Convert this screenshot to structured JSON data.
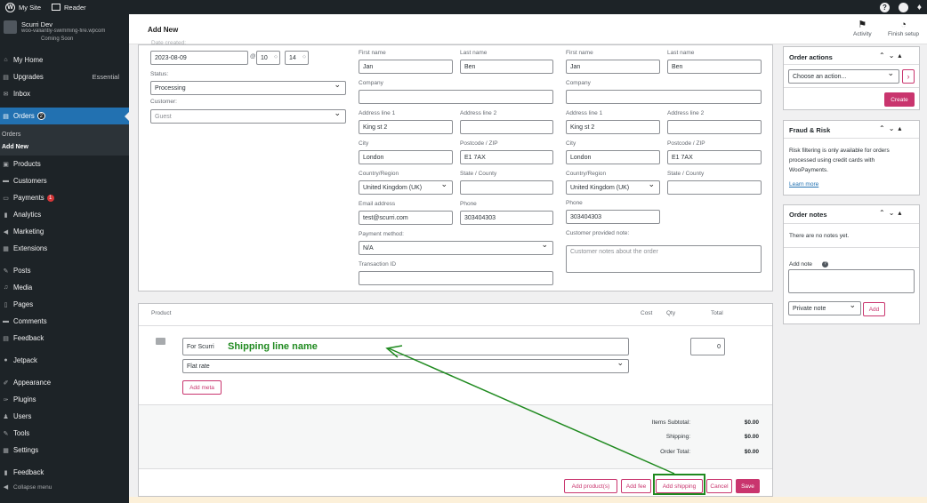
{
  "adminbar": {
    "my_site": "My Site",
    "reader": "Reader",
    "help_glyph": "?"
  },
  "site": {
    "name": "Scurri Dev",
    "url": "woo-valiantly-swimming-fire.wpcom",
    "status": "Coming Soon"
  },
  "nav": {
    "my_home": "My Home",
    "upgrades": "Upgrades",
    "upgrades_plan": "Essential",
    "inbox": "Inbox",
    "orders": "Orders",
    "orders_count": "2",
    "orders_sub": "Orders",
    "add_new": "Add New",
    "products": "Products",
    "customers": "Customers",
    "payments": "Payments",
    "payments_count": "1",
    "analytics": "Analytics",
    "marketing": "Marketing",
    "extensions": "Extensions",
    "posts": "Posts",
    "media": "Media",
    "pages": "Pages",
    "comments": "Comments",
    "feedback": "Feedback",
    "jetpack": "Jetpack",
    "appearance": "Appearance",
    "plugins": "Plugins",
    "users": "Users",
    "tools": "Tools",
    "settings": "Settings",
    "feedback2": "Feedback",
    "collapse": "Collapse menu"
  },
  "header": {
    "title": "Add New",
    "activity": "Activity",
    "finish_setup": "Finish setup"
  },
  "general": {
    "date_label": "Date created:",
    "date": "2023-08-09",
    "at": "@",
    "hour": "10",
    "minute": "14",
    "status_label": "Status:",
    "status": "Processing",
    "customer_label": "Customer:",
    "customer": "Guest"
  },
  "billing": {
    "first_name_label": "First name",
    "first_name": "Jan",
    "last_name_label": "Last name",
    "last_name": "Ben",
    "company_label": "Company",
    "company": "",
    "address1_label": "Address line 1",
    "address1": "King st 2",
    "address2_label": "Address line 2",
    "address2": "",
    "city_label": "City",
    "city": "London",
    "postcode_label": "Postcode / ZIP",
    "postcode": "E1 7AX",
    "country_label": "Country/Region",
    "country": "United Kingdom (UK)",
    "state_label": "State / County",
    "state": "",
    "email_label": "Email address",
    "email": "test@scurri.com",
    "phone_label": "Phone",
    "phone": "303404303",
    "payment_label": "Payment method:",
    "payment": "N/A",
    "transaction_label": "Transaction ID",
    "transaction": ""
  },
  "shipping": {
    "first_name_label": "First name",
    "first_name": "Jan",
    "last_name_label": "Last name",
    "last_name": "Ben",
    "company_label": "Company",
    "company": "",
    "address1_label": "Address line 1",
    "address1": "King st 2",
    "address2_label": "Address line 2",
    "address2": "",
    "city_label": "City",
    "city": "London",
    "postcode_label": "Postcode / ZIP",
    "postcode": "E1 7AX",
    "country_label": "Country/Region",
    "country": "United Kingdom (UK)",
    "state_label": "State / County",
    "state": "",
    "phone_label": "Phone",
    "phone": "303404303",
    "note_label": "Customer provided note:",
    "note_placeholder": "Customer notes about the order"
  },
  "items": {
    "col_product": "Product",
    "col_cost": "Cost",
    "col_qty": "Qty",
    "col_total": "Total",
    "line_name": "For Scurri",
    "method": "Flat rate",
    "line_total": "0",
    "add_meta": "Add meta",
    "subtotal_label": "Items Subtotal:",
    "subtotal": "$0.00",
    "shipping_label": "Shipping:",
    "shipping": "$0.00",
    "total_label": "Order Total:",
    "total": "$0.00",
    "btn_add_products": "Add product(s)",
    "btn_add_fee": "Add fee",
    "btn_add_shipping": "Add shipping",
    "btn_cancel": "Cancel",
    "btn_save": "Save"
  },
  "annotation": {
    "text": "Shipping line name",
    "color": "#1f8a1f"
  },
  "order_actions": {
    "title": "Order actions",
    "placeholder": "Choose an action...",
    "create": "Create"
  },
  "fraud": {
    "title": "Fraud & Risk",
    "text1": "Risk filtering is only available for orders",
    "text2": "processed using credit cards with",
    "text3": "WooPayments.",
    "link": "Learn more"
  },
  "notes": {
    "title": "Order notes",
    "empty": "There are no notes yet.",
    "add_label": "Add note",
    "note_type": "Private note",
    "add_btn": "Add"
  },
  "colors": {
    "accent": "#c9356e",
    "wp_blue": "#2271b1",
    "sidebar": "#1d2327"
  }
}
